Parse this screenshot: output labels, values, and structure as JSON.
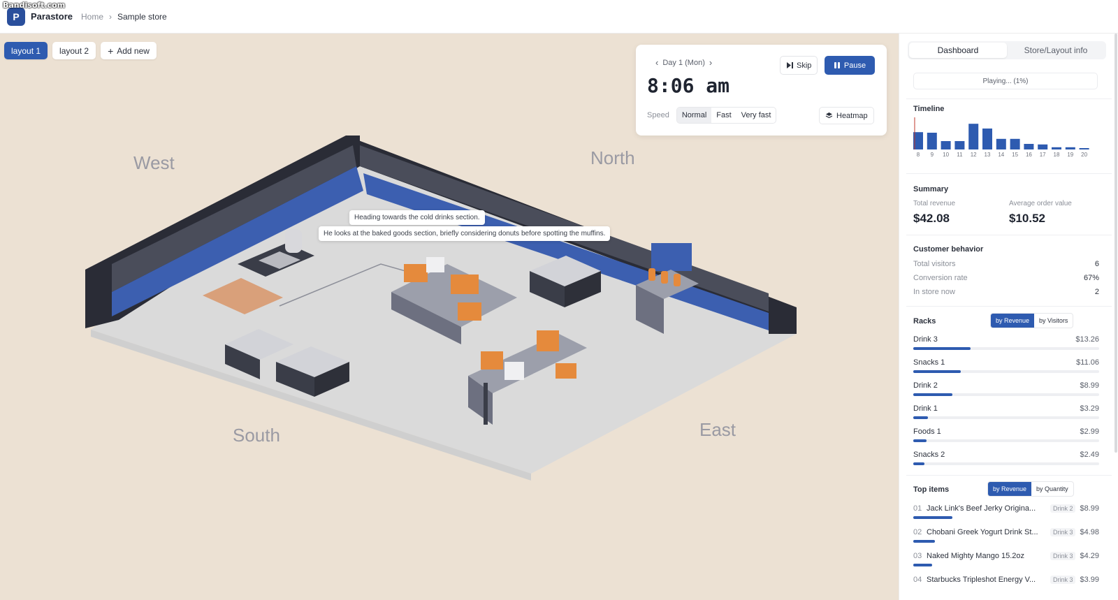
{
  "watermark": "Bandisoft.com",
  "app": {
    "logo_letter": "P",
    "name": "Parastore"
  },
  "breadcrumb": {
    "home": "Home",
    "current": "Sample store"
  },
  "layout_tabs": [
    "layout 1",
    "layout 2"
  ],
  "add_new_label": "Add new",
  "directions": {
    "west": "West",
    "north": "North",
    "south": "South",
    "east": "East"
  },
  "controls": {
    "day": "Day 1 (Mon)",
    "time": "8:06 am",
    "skip": "Skip",
    "pause": "Pause",
    "speed_label": "Speed",
    "speeds": [
      "Normal",
      "Fast",
      "Very fast"
    ],
    "active_speed": "Normal",
    "heatmap": "Heatmap"
  },
  "bubbles": [
    "Heading towards the cold drinks section.",
    "He looks at the baked goods section, briefly considering donuts before spotting the muffins."
  ],
  "panel": {
    "tabs": [
      "Dashboard",
      "Store/Layout info"
    ],
    "playing": "Playing... (1%)",
    "timeline": {
      "title": "Timeline",
      "hours": [
        "8",
        "9",
        "10",
        "11",
        "12",
        "13",
        "14",
        "15",
        "16",
        "17",
        "18",
        "19",
        "20"
      ],
      "values": [
        0.62,
        0.6,
        0.3,
        0.3,
        0.92,
        0.75,
        0.38,
        0.38,
        0.2,
        0.18,
        0.08,
        0.08,
        0.0
      ],
      "current_hour_fraction": 0.1
    },
    "summary": {
      "title": "Summary",
      "total_revenue_label": "Total revenue",
      "total_revenue": "$42.08",
      "aov_label": "Average order value",
      "aov": "$10.52"
    },
    "behavior": {
      "title": "Customer behavior",
      "rows": [
        {
          "label": "Total visitors",
          "value": "6"
        },
        {
          "label": "Conversion rate",
          "value": "67%"
        },
        {
          "label": "In store now",
          "value": "2"
        }
      ]
    },
    "racks": {
      "title": "Racks",
      "toggle": [
        "by Revenue",
        "by Visitors"
      ],
      "items": [
        {
          "name": "Drink 3",
          "value": "$13.26",
          "share": 1.0
        },
        {
          "name": "Snacks 1",
          "value": "$11.06",
          "share": 0.83
        },
        {
          "name": "Drink 2",
          "value": "$8.99",
          "share": 0.68
        },
        {
          "name": "Drink 1",
          "value": "$3.29",
          "share": 0.25
        },
        {
          "name": "Foods 1",
          "value": "$2.99",
          "share": 0.23
        },
        {
          "name": "Snacks 2",
          "value": "$2.49",
          "share": 0.19
        }
      ]
    },
    "top_items": {
      "title": "Top items",
      "toggle": [
        "by Revenue",
        "by Quantity"
      ],
      "items": [
        {
          "rank": "01",
          "name": "Jack Link's Beef Jerky Origina...",
          "rack": "Drink 2",
          "price": "$8.99",
          "share": 1.0
        },
        {
          "rank": "02",
          "name": "Chobani Greek Yogurt Drink St...",
          "rack": "Drink 3",
          "price": "$4.98",
          "share": 0.55
        },
        {
          "rank": "03",
          "name": "Naked Mighty Mango 15.2oz",
          "rack": "Drink 3",
          "price": "$4.29",
          "share": 0.48
        },
        {
          "rank": "04",
          "name": "Starbucks Tripleshot Energy V...",
          "rack": "Drink 3",
          "price": "$3.99",
          "share": 0.44
        }
      ]
    }
  }
}
